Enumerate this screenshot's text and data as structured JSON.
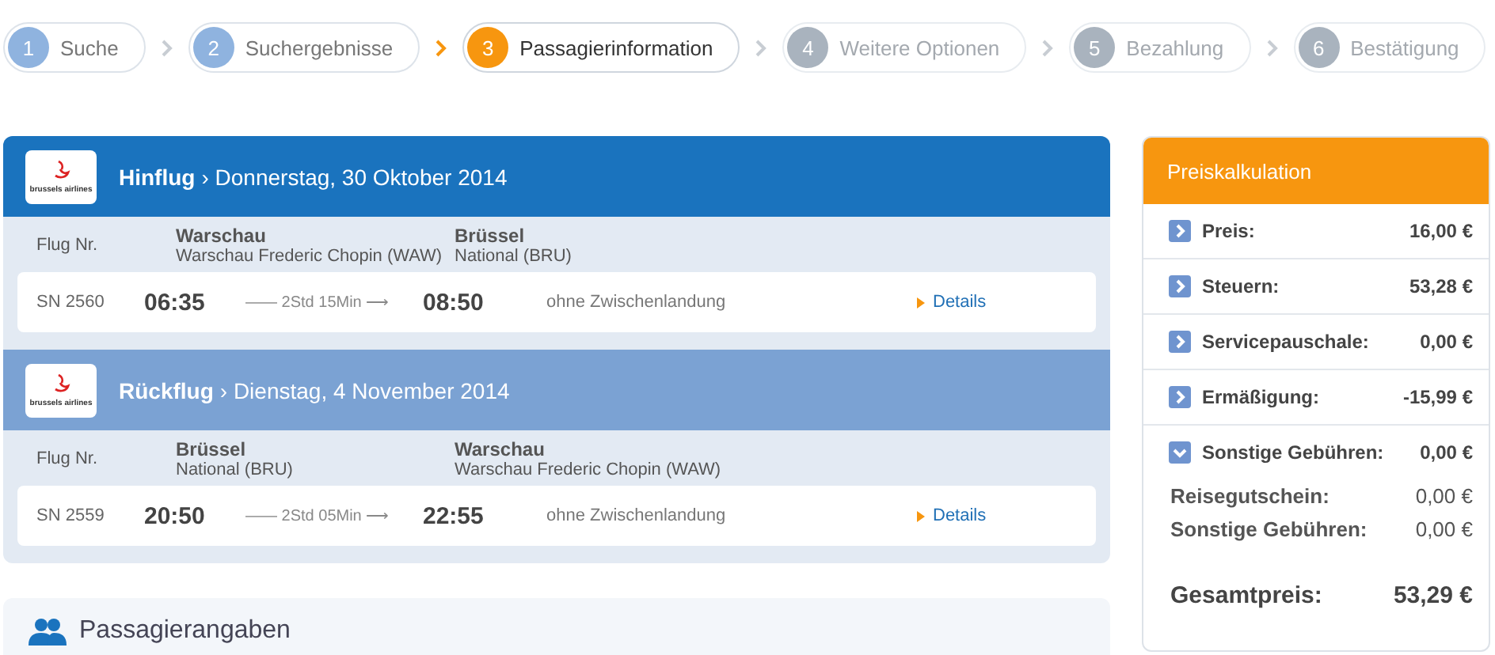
{
  "steps": [
    {
      "number": "1",
      "label": "Suche",
      "kind": "done"
    },
    {
      "number": "2",
      "label": "Suchergebnisse",
      "kind": "done"
    },
    {
      "number": "3",
      "label": "Passagierinformation",
      "kind": "active"
    },
    {
      "number": "4",
      "label": "Weitere Optionen",
      "kind": "upcoming"
    },
    {
      "number": "5",
      "label": "Bezahlung",
      "kind": "upcoming"
    },
    {
      "number": "6",
      "label": "Bestätigung",
      "kind": "upcoming"
    }
  ],
  "flights": [
    {
      "direction": "Hinflug",
      "date": "› Donnerstag, 30 Oktober 2014",
      "selected": true,
      "airline_logo_text": "brussels airlines",
      "flight_no_label": "Flug Nr.",
      "from_city": "Warschau",
      "from_airport": "Warschau Frederic Chopin (WAW)",
      "to_city": "Brüssel",
      "to_airport": "National (BRU)",
      "flight_no": "SN 2560",
      "departure": "06:35",
      "duration": "—— 2Std 15Min ⟶",
      "arrival": "08:50",
      "stops": "ohne Zwischenlandung",
      "details": "Details"
    },
    {
      "direction": "Rückflug",
      "date": "› Dienstag, 4 November 2014",
      "selected": false,
      "airline_logo_text": "brussels airlines",
      "flight_no_label": "Flug Nr.",
      "from_city": "Brüssel",
      "from_airport": "National (BRU)",
      "to_city": "Warschau",
      "to_airport": "Warschau Frederic Chopin (WAW)",
      "flight_no": "SN 2559",
      "departure": "20:50",
      "duration": "—— 2Std 05Min ⟶",
      "arrival": "22:55",
      "stops": "ohne Zwischenlandung",
      "details": "Details"
    }
  ],
  "passengers": {
    "title": "Passagierangaben"
  },
  "price": {
    "title": "Preiskalkulation",
    "items": [
      {
        "label": "Preis:",
        "value": "16,00 €",
        "expanded": false
      },
      {
        "label": "Steuern:",
        "value": "53,28 €",
        "expanded": false
      },
      {
        "label": "Servicepauschale:",
        "value": "0,00 €",
        "expanded": false
      },
      {
        "label": "Ermäßigung:",
        "value": "-15,99 €",
        "expanded": false
      },
      {
        "label": "Sonstige Gebühren:",
        "value": "0,00 €",
        "expanded": true,
        "children": [
          {
            "label": "Reisegutschein:",
            "value": "0,00 €"
          },
          {
            "label": "Sonstige Gebühren:",
            "value": "0,00 €"
          }
        ]
      }
    ],
    "total_label": "Gesamtpreis:",
    "total_value": "53,29 €"
  }
}
